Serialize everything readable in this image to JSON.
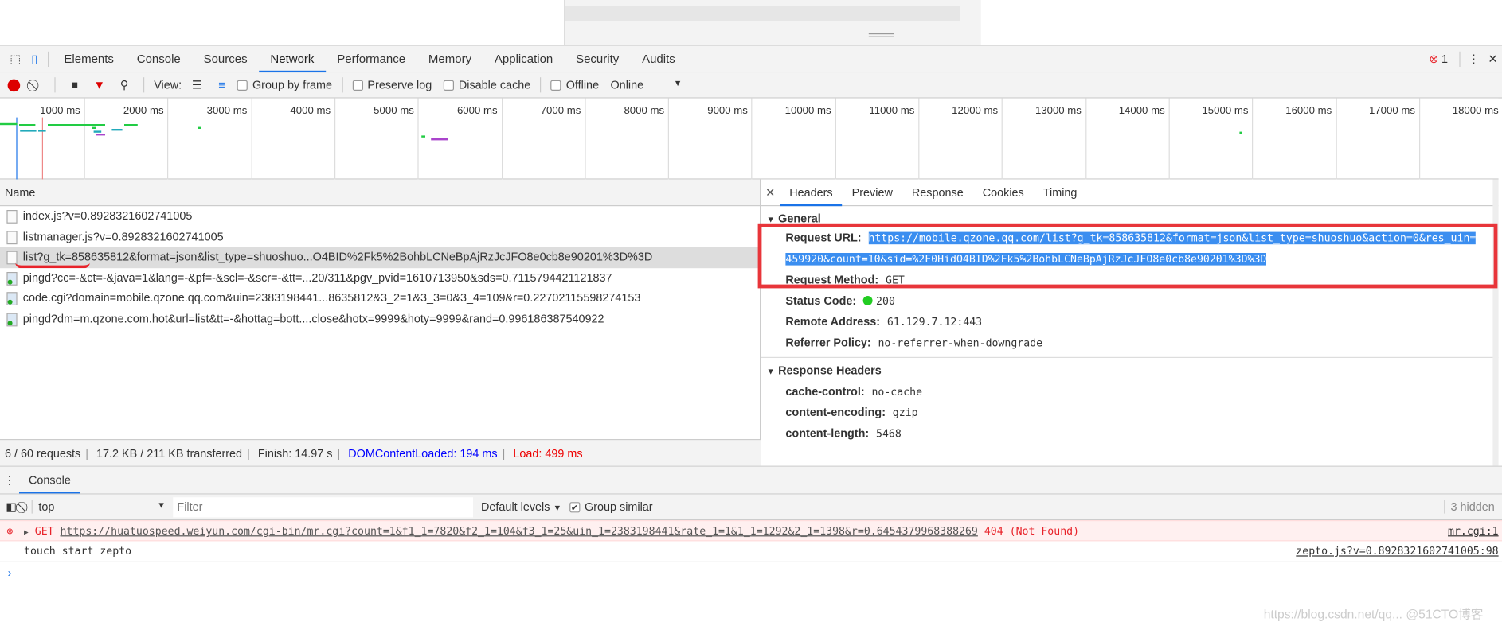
{
  "tabs": [
    "Elements",
    "Console",
    "Sources",
    "Network",
    "Performance",
    "Memory",
    "Application",
    "Security",
    "Audits"
  ],
  "active_tab": "Network",
  "error_count": "1",
  "toolbar": {
    "view_label": "View:",
    "group_by_frame": "Group by frame",
    "preserve_log": "Preserve log",
    "disable_cache": "Disable cache",
    "offline": "Offline",
    "throttle": "Online"
  },
  "timeline": {
    "ticks": [
      "1000 ms",
      "2000 ms",
      "3000 ms",
      "4000 ms",
      "5000 ms",
      "6000 ms",
      "7000 ms",
      "8000 ms",
      "9000 ms",
      "10000 ms",
      "11000 ms",
      "12000 ms",
      "13000 ms",
      "14000 ms",
      "15000 ms",
      "16000 ms",
      "17000 ms",
      "18000 ms"
    ],
    "domcontentloaded_ms": 194,
    "load_ms": 499
  },
  "requests": {
    "header": "Name",
    "rows": [
      {
        "name": "index.js?v=0.8928321602741005",
        "type": "script"
      },
      {
        "name": "listmanager.js?v=0.8928321602741005",
        "type": "script"
      },
      {
        "name": "list?g_tk=858635812&format=json&list_type=shuoshuo...O4BID%2Fk5%2BohbLCNeBpAjRzJcJFO8e0cb8e90201%3D%3D",
        "type": "doc",
        "selected": true
      },
      {
        "name": "pingd?cc=-&ct=-&java=1&lang=-&pf=-&scl=-&scr=-&tt=...20/311&pgv_pvid=1610713950&sds=0.7115794421121837",
        "type": "img"
      },
      {
        "name": "code.cgi?domain=mobile.qzone.qq.com&uin=2383198441...8635812&3_2=1&3_3=0&3_4=109&r=0.22702115598274153",
        "type": "img"
      },
      {
        "name": "pingd?dm=m.qzone.com.hot&url=list&tt=-&hottag=bott....close&hotx=9999&hoty=9999&rand=0.996186387540922",
        "type": "img"
      }
    ]
  },
  "status": {
    "requests": "6 / 60 requests",
    "transferred": "17.2 KB / 211 KB transferred",
    "finish": "Finish: 14.97 s",
    "dcl": "DOMContentLoaded: 194 ms",
    "load": "Load: 499 ms"
  },
  "detail": {
    "tabs": [
      "Headers",
      "Preview",
      "Response",
      "Cookies",
      "Timing"
    ],
    "general_title": "General",
    "request_url_label": "Request URL:",
    "request_url_1": "https://mobile.qzone.qq.com/list?g_tk=858635812&format=json&list_type=shuoshuo&action=0&res_uin=",
    "request_url_2": "459920&count=10&sid=%2F0HidO4BID%2Fk5%2BohbLCNeBpAjRzJcJFO8e0cb8e90201%3D%3D",
    "request_method_label": "Request Method:",
    "request_method": "GET",
    "status_label": "Status Code:",
    "status": "200",
    "remote_label": "Remote Address:",
    "remote": "61.129.7.12:443",
    "referrer_label": "Referrer Policy:",
    "referrer": "no-referrer-when-downgrade",
    "response_title": "Response Headers",
    "response_headers": [
      {
        "k": "cache-control:",
        "v": "no-cache"
      },
      {
        "k": "content-encoding:",
        "v": "gzip"
      },
      {
        "k": "content-length:",
        "v": "5468"
      }
    ]
  },
  "console": {
    "tab": "Console",
    "context": "top",
    "filter_placeholder": "Filter",
    "levels": "Default levels",
    "group_similar": "Group similar",
    "hidden": "3 hidden",
    "messages": [
      {
        "level": "error",
        "method": "GET",
        "url": "https://huatuospeed.weiyun.com/cgi-bin/mr.cgi?count=1&f1_1=7820&f2_1=104&f3_1=25&uin_1=2383198441&rate_1=1&1_1=1292&2_1=1398&r=0.6454379968388269",
        "status": "404 (Not Found)",
        "source": "mr.cgi:1"
      },
      {
        "level": "log",
        "text": "touch start zepto",
        "source": "zepto.js?v=0.8928321602741005:98"
      }
    ]
  },
  "watermark": "https://blog.csdn.net/qq... @51CTO博客",
  "colors": {
    "accent": "#1a73e8",
    "highlight": "#e8353a",
    "selection": "#3b8ef0",
    "error": "#e8232a"
  }
}
